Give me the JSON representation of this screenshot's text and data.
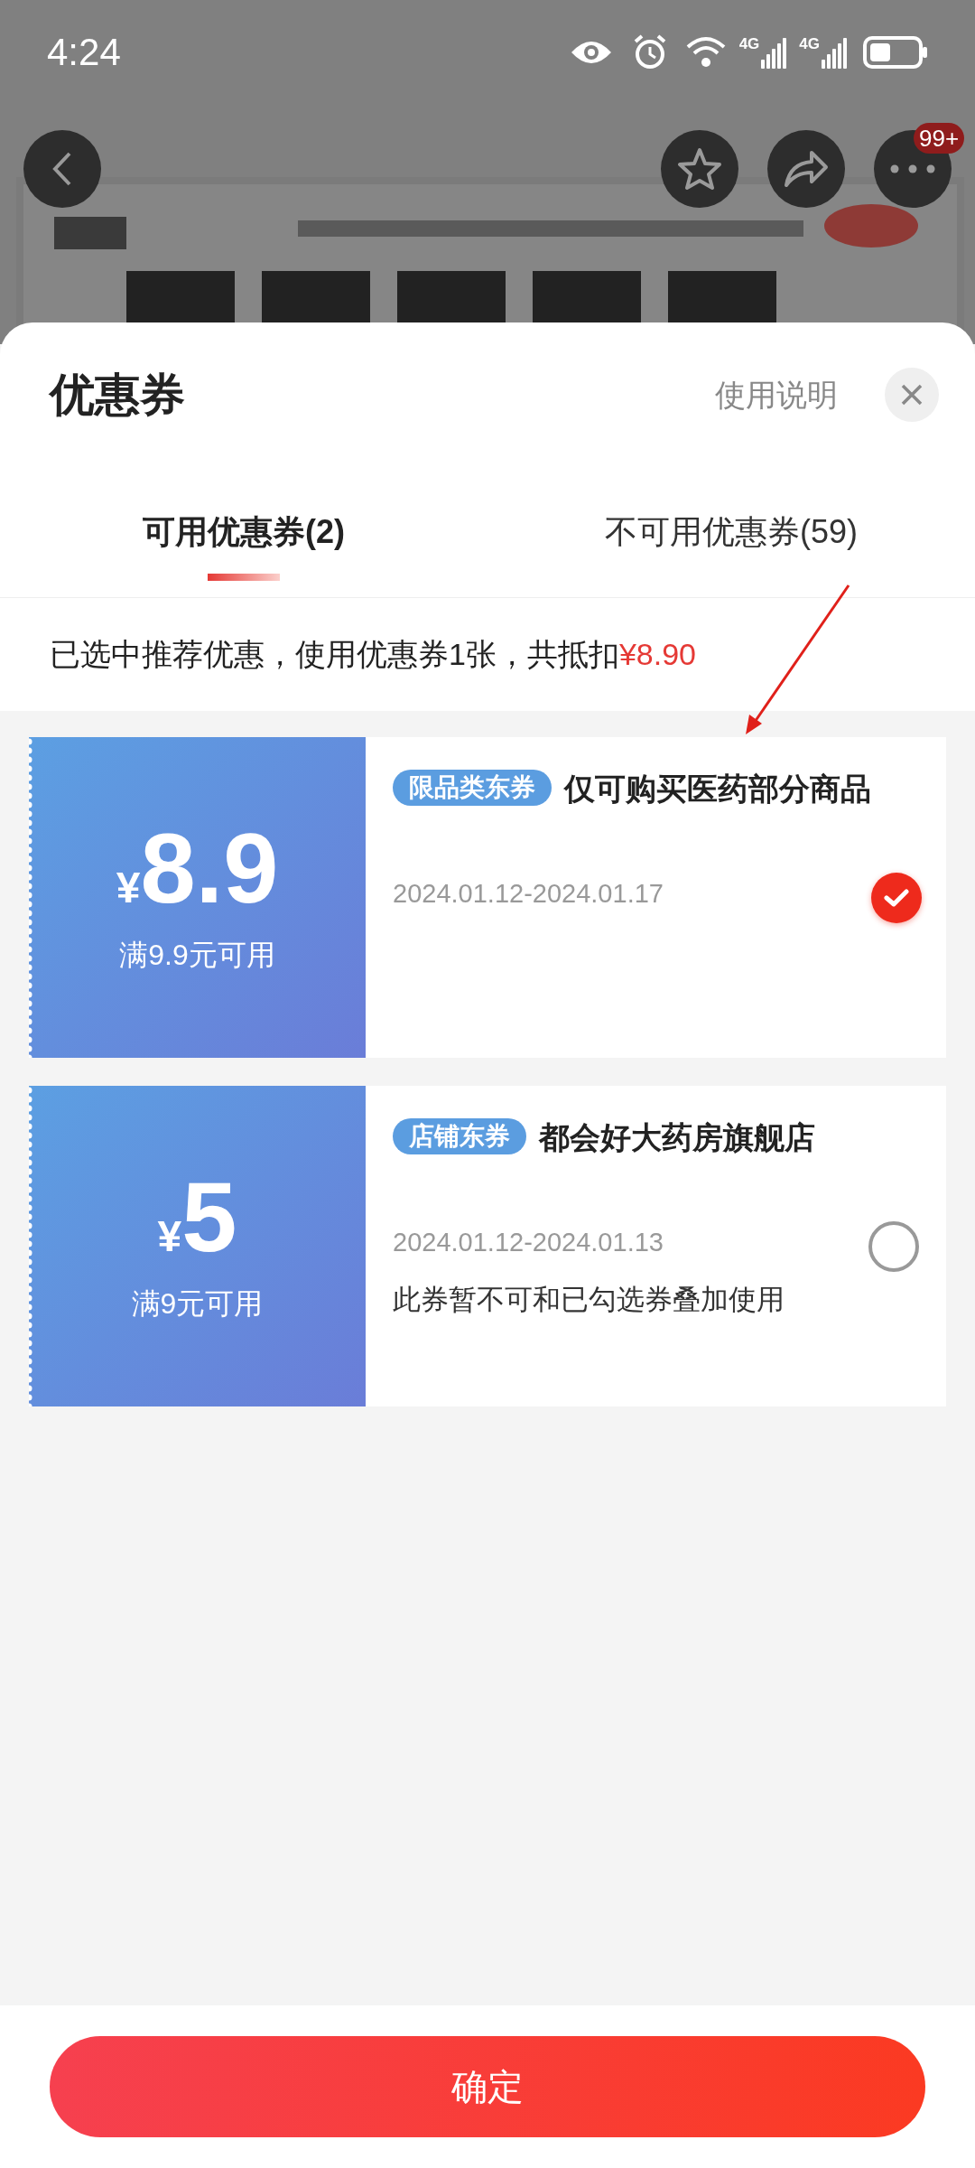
{
  "status_bar": {
    "time": "4:24",
    "signals": [
      {
        "label": "4G"
      },
      {
        "label": "4G"
      }
    ]
  },
  "top_bar": {
    "badge": "99+"
  },
  "sheet": {
    "title": "优惠券",
    "help_link": "使用说明"
  },
  "tabs": [
    {
      "label": "可用优惠券(2)",
      "selected": true
    },
    {
      "label": "不可用优惠券(59)",
      "selected": false
    }
  ],
  "summary": {
    "text": "已选中推荐优惠，使用优惠券1张，共抵扣",
    "amount": "¥8.90"
  },
  "coupons": [
    {
      "currency": "¥",
      "amount": "8.9",
      "condition": "满9.9元可用",
      "tag": "限品类东券",
      "title": "仅可购买医药部分商品",
      "validity": "2024.01.12-2024.01.17",
      "selected": true
    },
    {
      "currency": "¥",
      "amount": "5",
      "condition": "满9元可用",
      "tag": "店铺东券",
      "title": "都会好大药房旗舰店",
      "validity": "2024.01.12-2024.01.13",
      "note": "此券暂不可和已勾选券叠加使用",
      "selected": false
    }
  ],
  "confirm_button": "确定"
}
